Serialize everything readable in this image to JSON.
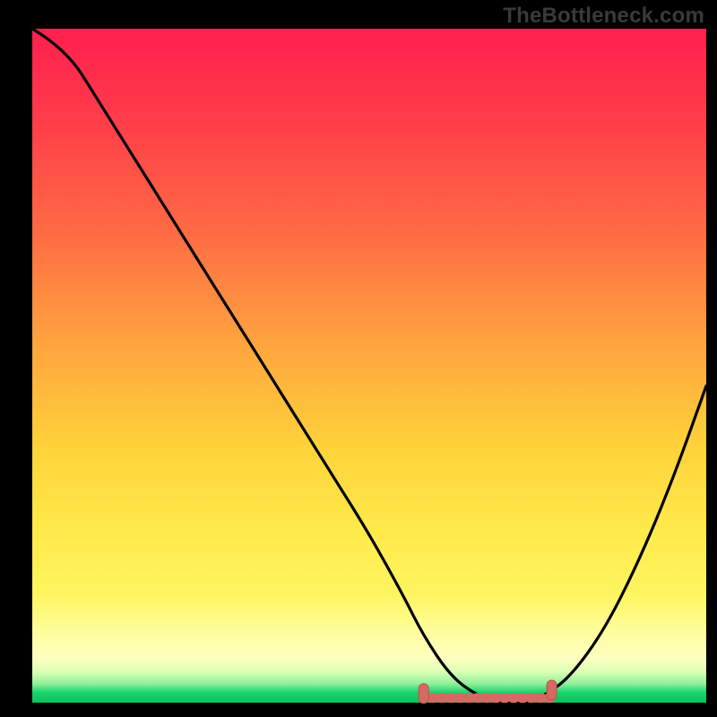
{
  "watermark": "TheBottleneck.com",
  "colors": {
    "gradient_top": "#ff1f4e",
    "gradient_mid1": "#ff7a3f",
    "gradient_mid2": "#ffd23a",
    "gradient_mid3": "#fff560",
    "gradient_bottom_yellow": "#fdffc0",
    "gradient_green": "#17d46b",
    "curve": "#000000",
    "marker_fill": "#d36a63",
    "marker_stroke": "#c24e45",
    "frame": "#000000"
  },
  "chart_data": {
    "type": "line",
    "title": "",
    "xlabel": "",
    "ylabel": "",
    "xlim": [
      0,
      100
    ],
    "ylim": [
      0,
      100
    ],
    "series": [
      {
        "name": "bottleneck-curve",
        "x": [
          0,
          5,
          10,
          15,
          20,
          25,
          30,
          35,
          40,
          45,
          50,
          55,
          58,
          62,
          66,
          70,
          73,
          76,
          80,
          85,
          90,
          95,
          100
        ],
        "y": [
          104,
          97,
          89,
          81,
          73,
          65,
          57,
          49,
          41,
          33,
          25,
          16,
          10,
          4,
          1,
          0,
          0,
          1,
          4,
          11,
          21,
          33,
          47
        ]
      }
    ],
    "optimal_band": {
      "x_start": 58,
      "x_end": 77,
      "y": 0.7
    },
    "markers": [
      {
        "x": 58,
        "y": 1.5
      },
      {
        "x": 77,
        "y": 2.0
      }
    ]
  }
}
